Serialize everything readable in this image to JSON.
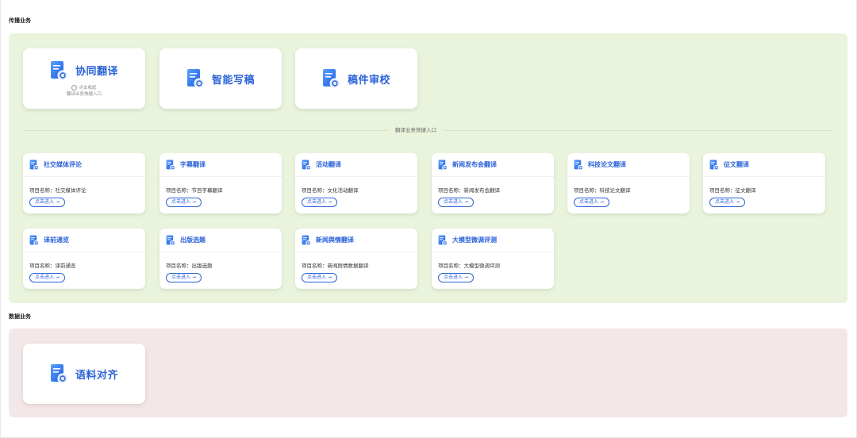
{
  "sections": {
    "broadcast_title": "传播业务",
    "data_title": "数据业务"
  },
  "big_cards": [
    {
      "title": "协同翻译",
      "collapse_text": "点击收起",
      "collapse_sub": "翻译业务快捷入口"
    },
    {
      "title": "智能写稿"
    },
    {
      "title": "稿件审校"
    }
  ],
  "divider_label": "翻译业务快捷入口",
  "cards": [
    {
      "title": "社交媒体评论",
      "project": "项目名称：社交媒体评论",
      "enter": "点击进入"
    },
    {
      "title": "字幕翻译",
      "project": "项目名称：节目字幕翻译",
      "enter": "点击进入"
    },
    {
      "title": "活动翻译",
      "project": "项目名称：文化活动翻译",
      "enter": "点击进入"
    },
    {
      "title": "新闻发布会翻译",
      "project": "项目名称：新闻发布会翻译",
      "enter": "点击进入"
    },
    {
      "title": "科技论文翻译",
      "project": "项目名称：科技论文翻译",
      "enter": "点击进入"
    },
    {
      "title": "征文翻译",
      "project": "项目名称：征文翻译",
      "enter": "点击进入"
    },
    {
      "title": "译前通览",
      "project": "项目名称：译前通览",
      "enter": "点击进入"
    },
    {
      "title": "出版选题",
      "project": "项目名称：出版选题",
      "enter": "点击进入"
    },
    {
      "title": "新闻舆情翻译",
      "project": "项目名称：新闻舆情数据翻译",
      "enter": "点击进入"
    },
    {
      "title": "大模型微调评测",
      "project": "项目名称：大模型微调评测",
      "enter": "点击进入"
    }
  ],
  "data_cards": [
    {
      "title": "语料对齐"
    }
  ],
  "colors": {
    "accent": "#2b63d9",
    "green_panel": "#eaf4dc",
    "pink_panel": "#f4e7e7"
  }
}
